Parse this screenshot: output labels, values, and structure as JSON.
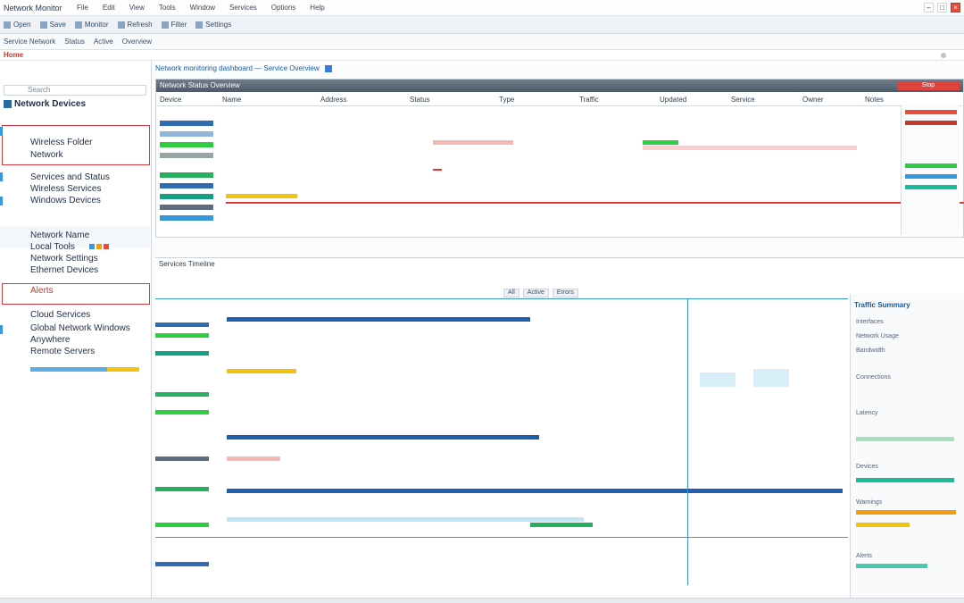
{
  "window": {
    "title": "Network Monitor",
    "menu": [
      "File",
      "Edit",
      "View",
      "Tools",
      "Window",
      "Services",
      "Options",
      "Help"
    ],
    "controls": [
      "–",
      "□",
      "×"
    ]
  },
  "toolbar": [
    "Open",
    "Save",
    "Monitor",
    "Refresh",
    "Filter",
    "Settings"
  ],
  "toolbar2": [
    "Service Network",
    "Status",
    "Active",
    "Overview"
  ],
  "address": {
    "tag": "Home"
  },
  "sidebar": {
    "search_placeholder": "Search",
    "header": "Network Devices",
    "items": [
      {
        "label": "Wireless Folder"
      },
      {
        "label": "Network"
      },
      {
        "label": "Services and Status"
      },
      {
        "label": "Wireless Services"
      },
      {
        "label": "Windows Devices"
      },
      {
        "label": "Network Name"
      },
      {
        "label": "Local Tools"
      },
      {
        "label": "Network Settings"
      },
      {
        "label": "Ethernet Devices"
      },
      {
        "label": "Alerts"
      },
      {
        "label": "Cloud Services"
      },
      {
        "label": "Global Network Windows"
      },
      {
        "label": "Anywhere"
      },
      {
        "label": "Remote Servers"
      }
    ]
  },
  "main": {
    "banner": "Network monitoring dashboard — Service Overview",
    "upper": {
      "header_title": "Network Status Overview",
      "action_label": "Stop",
      "columns": [
        "Device",
        "Name",
        "Address",
        "Status",
        "Type",
        "Traffic",
        "Updated",
        "Service",
        "Owner",
        "Notes"
      ]
    },
    "lower": {
      "header": "Services Timeline",
      "filters": [
        "All",
        "Active",
        "Errors"
      ],
      "right_title": "Traffic Summary",
      "right_labels": [
        "Interfaces",
        "Network Usage",
        "Bandwidth",
        "Connections",
        "Latency",
        "Devices",
        "Warnings",
        "Alerts"
      ]
    }
  },
  "colors": {
    "accent": "#3498db",
    "alert": "#e53935",
    "success": "#2ecc40",
    "warning": "#f1c40f",
    "header": "#4e5a68"
  }
}
